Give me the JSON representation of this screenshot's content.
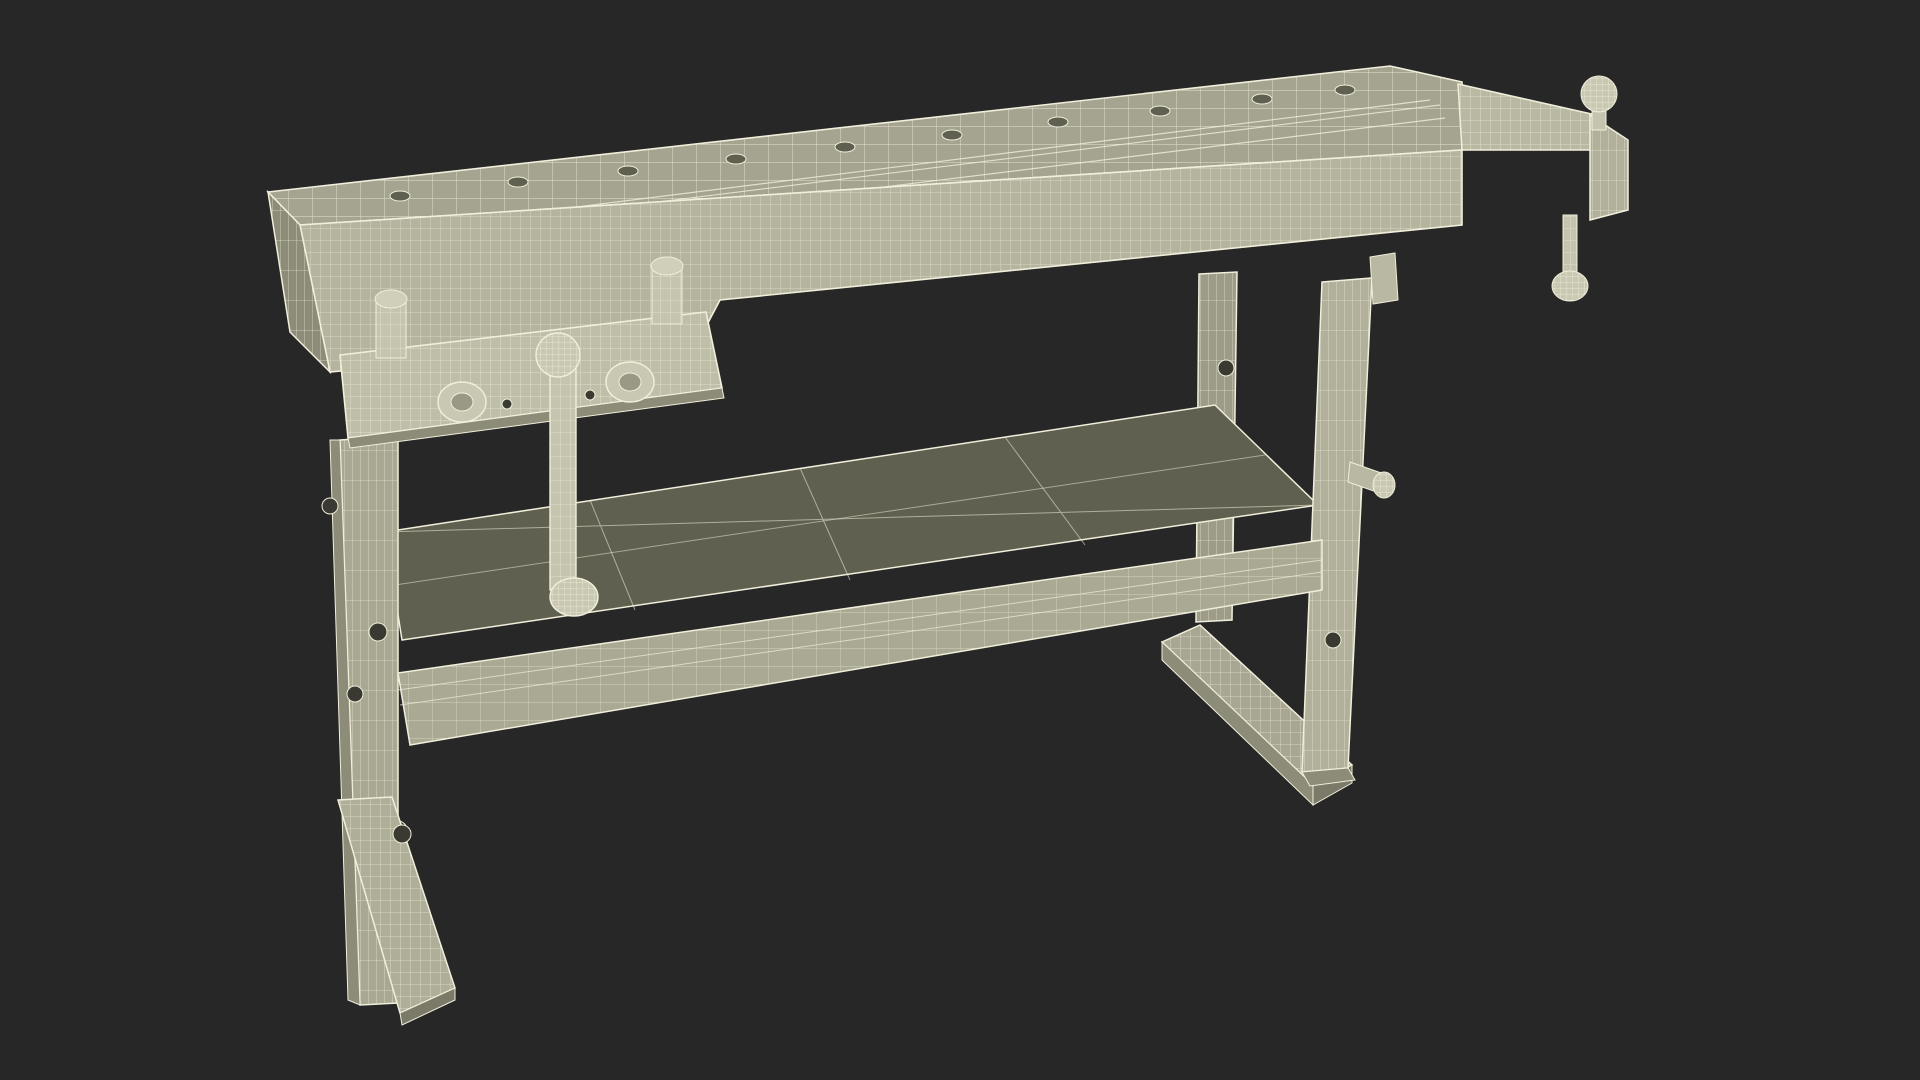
{
  "scene": {
    "subject": "workbench-wireframe-render",
    "colors": {
      "background": "#272727",
      "surface": "#a4a38f",
      "surface_light": "#b9b8a3",
      "surface_dark": "#7b7a68",
      "shelf": "#5f604f",
      "wire": "#f1efdb"
    }
  }
}
